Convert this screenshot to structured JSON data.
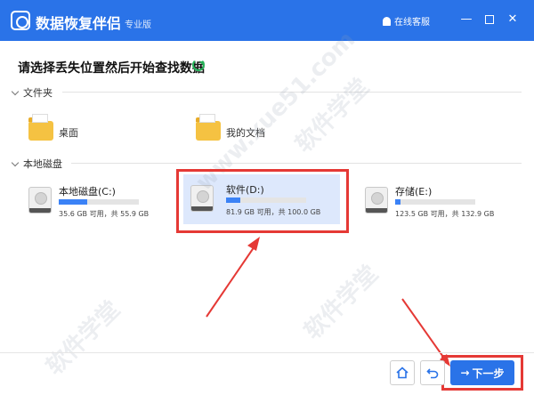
{
  "titlebar": {
    "app_title": "数据恢复伴侣",
    "edition": "专业版",
    "service_label": "在线客服",
    "minimize_glyph": "—",
    "close_glyph": "✕"
  },
  "main": {
    "heading": "请选择丢失位置然后开始查找数据",
    "refresh_icon": "refresh-icon"
  },
  "folders_section": {
    "label": "文件夹",
    "items": [
      {
        "label": "桌面"
      },
      {
        "label": "我的文档"
      }
    ]
  },
  "drives_section": {
    "label": "本地磁盘",
    "items": [
      {
        "name": "本地磁盘(C:)",
        "info": "35.6 GB 可用，共 55.9 GB",
        "used_fraction": 0.36
      },
      {
        "name": "软件(D:)",
        "info": "81.9 GB 可用，共 100.0 GB",
        "used_fraction": 0.18,
        "selected": true
      },
      {
        "name": "存储(E:)",
        "info": "123.5 GB 可用，共 132.9 GB",
        "used_fraction": 0.07
      }
    ]
  },
  "footer": {
    "home_icon": "home-icon",
    "back_icon": "back-icon",
    "next_label": "下一步",
    "next_arrow": "→"
  },
  "watermarks": [
    "软件学堂",
    "www.xue51.com"
  ],
  "colors": {
    "accent": "#2a73e8",
    "highlight": "#e53935",
    "selected_bg": "#dde8fc"
  }
}
